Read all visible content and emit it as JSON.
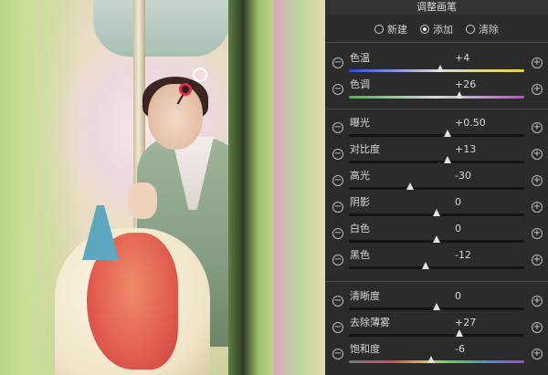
{
  "panel": {
    "title": "调整画笔",
    "modes": [
      {
        "label": "新建",
        "selected": false
      },
      {
        "label": "添加",
        "selected": true
      },
      {
        "label": "清除",
        "selected": false
      }
    ],
    "minus_glyph": "−",
    "plus_glyph": "+",
    "sliders": [
      {
        "label": "色温",
        "value": "+4",
        "level": 0.52,
        "track": "temp"
      },
      {
        "label": "色调",
        "value": "+26",
        "level": 0.63,
        "track": "tint"
      },
      {
        "label": "曝光",
        "value": "+0.50",
        "level": 0.56,
        "track": "dark"
      },
      {
        "label": "对比度",
        "value": "+13",
        "level": 0.56,
        "track": "dark"
      },
      {
        "label": "高光",
        "value": "-30",
        "level": 0.35,
        "track": "dark"
      },
      {
        "label": "阴影",
        "value": "0",
        "level": 0.5,
        "track": "dark"
      },
      {
        "label": "白色",
        "value": "0",
        "level": 0.5,
        "track": "dark"
      },
      {
        "label": "黑色",
        "value": "-12",
        "level": 0.44,
        "track": "dark"
      },
      {
        "label": "清晰度",
        "value": "0",
        "level": 0.5,
        "track": "dark"
      },
      {
        "label": "去除薄雾",
        "value": "+27",
        "level": 0.63,
        "track": "dark"
      },
      {
        "label": "饱和度",
        "value": "-6",
        "level": 0.47,
        "track": "sat"
      }
    ]
  },
  "colors": {
    "panel_bg": "#2b2b2b",
    "text": "#d8d8d8",
    "brush_ring": "#e3254b"
  },
  "icons": {
    "minus": "minus-circle-icon",
    "plus": "plus-circle-icon",
    "brush": "brush-pin-icon"
  }
}
